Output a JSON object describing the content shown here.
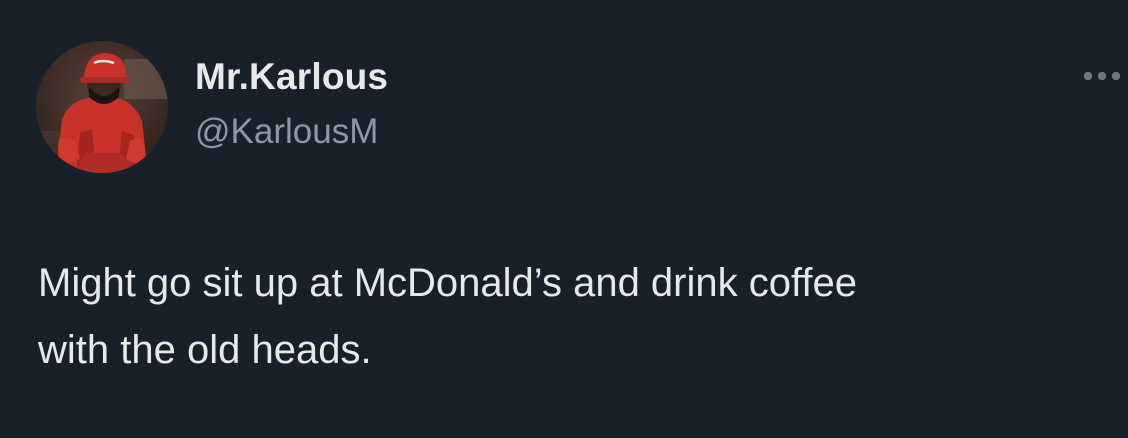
{
  "user": {
    "display_name": "Mr.Karlous",
    "handle": "@KarlousM",
    "avatar": "profile-photo"
  },
  "tweet": {
    "text_line_1": "Might go sit up at McDonald’s and drink coffee",
    "text_line_2": "with the old heads."
  },
  "icons": {
    "more": "more-options-icon"
  },
  "colors": {
    "background": "#17202b",
    "primary_text": "#e7e9ea",
    "secondary_text": "#8b98a5"
  }
}
